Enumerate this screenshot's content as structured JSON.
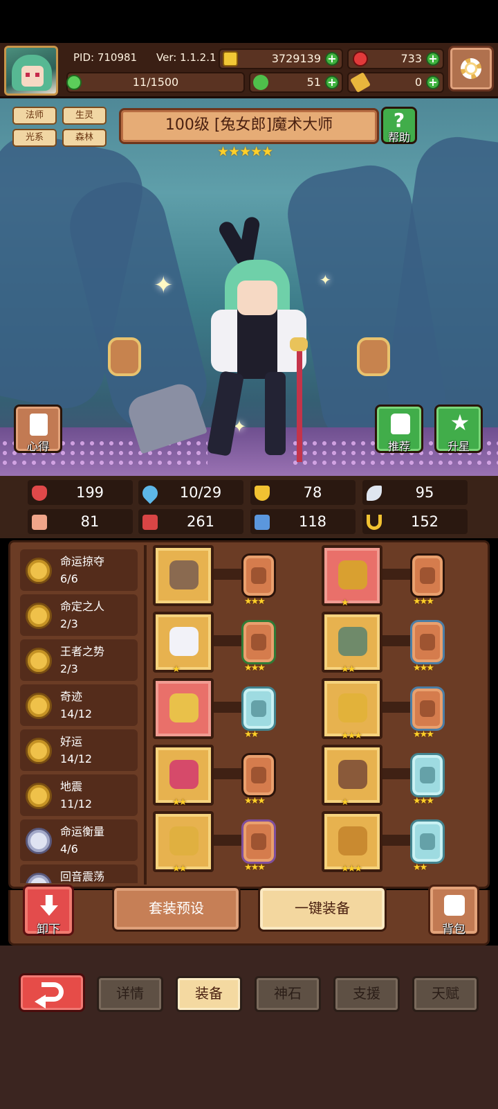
{
  "header": {
    "pid": "PID: 710981",
    "version": "Ver: 1.1.2.1",
    "gold": "3729139",
    "gems": "733",
    "exp": "11/1500",
    "clover": "51",
    "keys": "0"
  },
  "hero": {
    "tags": [
      "法师",
      "生灵",
      "光系",
      "森林"
    ],
    "title": "100级  [兔女郎]魔术大师",
    "stars": "★★★★★",
    "help_label": "帮助",
    "insight_label": "心得",
    "recommend_label": "推荐",
    "starup_label": "升星"
  },
  "stats": [
    {
      "icon": "heart-icon",
      "value": "199",
      "color": "#e0494a"
    },
    {
      "icon": "mana-drop-icon",
      "value": "10/29",
      "color": "#5db7e8"
    },
    {
      "icon": "shield-icon",
      "value": "78",
      "color": "#f1c232"
    },
    {
      "icon": "wing-icon",
      "value": "95",
      "color": "#dfe6f0"
    },
    {
      "icon": "fist-icon",
      "value": "81",
      "color": "#f0a58a"
    },
    {
      "icon": "spellbook-icon",
      "value": "261",
      "color": "#d94545"
    },
    {
      "icon": "magic-defense-icon",
      "value": "118",
      "color": "#5b97dd"
    },
    {
      "icon": "horseshoe-icon",
      "value": "152",
      "color": "#f1c232"
    }
  ],
  "skills": [
    {
      "name": "命运掠夺",
      "count": "6/6",
      "tier": "gold"
    },
    {
      "name": "命定之人",
      "count": "2/3",
      "tier": "gold"
    },
    {
      "name": "王者之势",
      "count": "2/3",
      "tier": "gold"
    },
    {
      "name": "奇迹",
      "count": "14/12",
      "tier": "gold"
    },
    {
      "name": "好运",
      "count": "14/12",
      "tier": "gold"
    },
    {
      "name": "地震",
      "count": "11/12",
      "tier": "gold"
    },
    {
      "name": "命运衡量",
      "count": "4/6",
      "tier": "silver"
    },
    {
      "name": "回音震荡",
      "count": "",
      "tier": "silver"
    }
  ],
  "equipment": [
    {
      "slot": "scepter-icon",
      "frame": "gold",
      "stars": "",
      "stone": "bronze",
      "stone_border": "dark",
      "stone_stars": "★★★"
    },
    {
      "slot": "straw-hat-icon",
      "frame": "red",
      "stars": "★",
      "stone": "bronze",
      "stone_border": "dark",
      "stone_stars": "★★★"
    },
    {
      "slot": "crystal-orb-icon",
      "frame": "gold",
      "stars": "★",
      "stone": "bronze",
      "stone_border": "green",
      "stone_stars": "★★★"
    },
    {
      "slot": "armor-vest-icon",
      "frame": "gold",
      "stars": "★★",
      "stone": "bronze",
      "stone_border": "blue",
      "stone_stars": "★★★"
    },
    {
      "slot": "heart-pendant-icon",
      "frame": "red",
      "stars": "",
      "stone": "aqua",
      "stone_border": "dark",
      "stone_stars": "★★"
    },
    {
      "slot": "golden-gauntlet-icon",
      "frame": "gold",
      "stars": "★★★",
      "stone": "bronze",
      "stone_border": "blue",
      "stone_stars": "★★★"
    },
    {
      "slot": "jeweled-brooch-icon",
      "frame": "gold",
      "stars": "★★",
      "stone": "bronze",
      "stone_border": "dark",
      "stone_stars": "★★★"
    },
    {
      "slot": "tiara-icon",
      "frame": "gold",
      "stars": "★",
      "stone": "aqua",
      "stone_border": "dark",
      "stone_stars": "★★★"
    },
    {
      "slot": "gem-ring-icon",
      "frame": "gold",
      "stars": "★★",
      "stone": "bronze",
      "stone_border": "purple",
      "stone_stars": "★★★"
    },
    {
      "slot": "golden-boots-icon",
      "frame": "gold",
      "stars": "★★★",
      "stone": "aqua",
      "stone_border": "dark",
      "stone_stars": "★★"
    }
  ],
  "actions": {
    "unload": "卸下",
    "preset": "套装预设",
    "equip_all": "一键装备",
    "bag": "背包"
  },
  "tabs": [
    "详情",
    "装备",
    "神石",
    "支援",
    "天赋"
  ],
  "active_tab": "装备"
}
